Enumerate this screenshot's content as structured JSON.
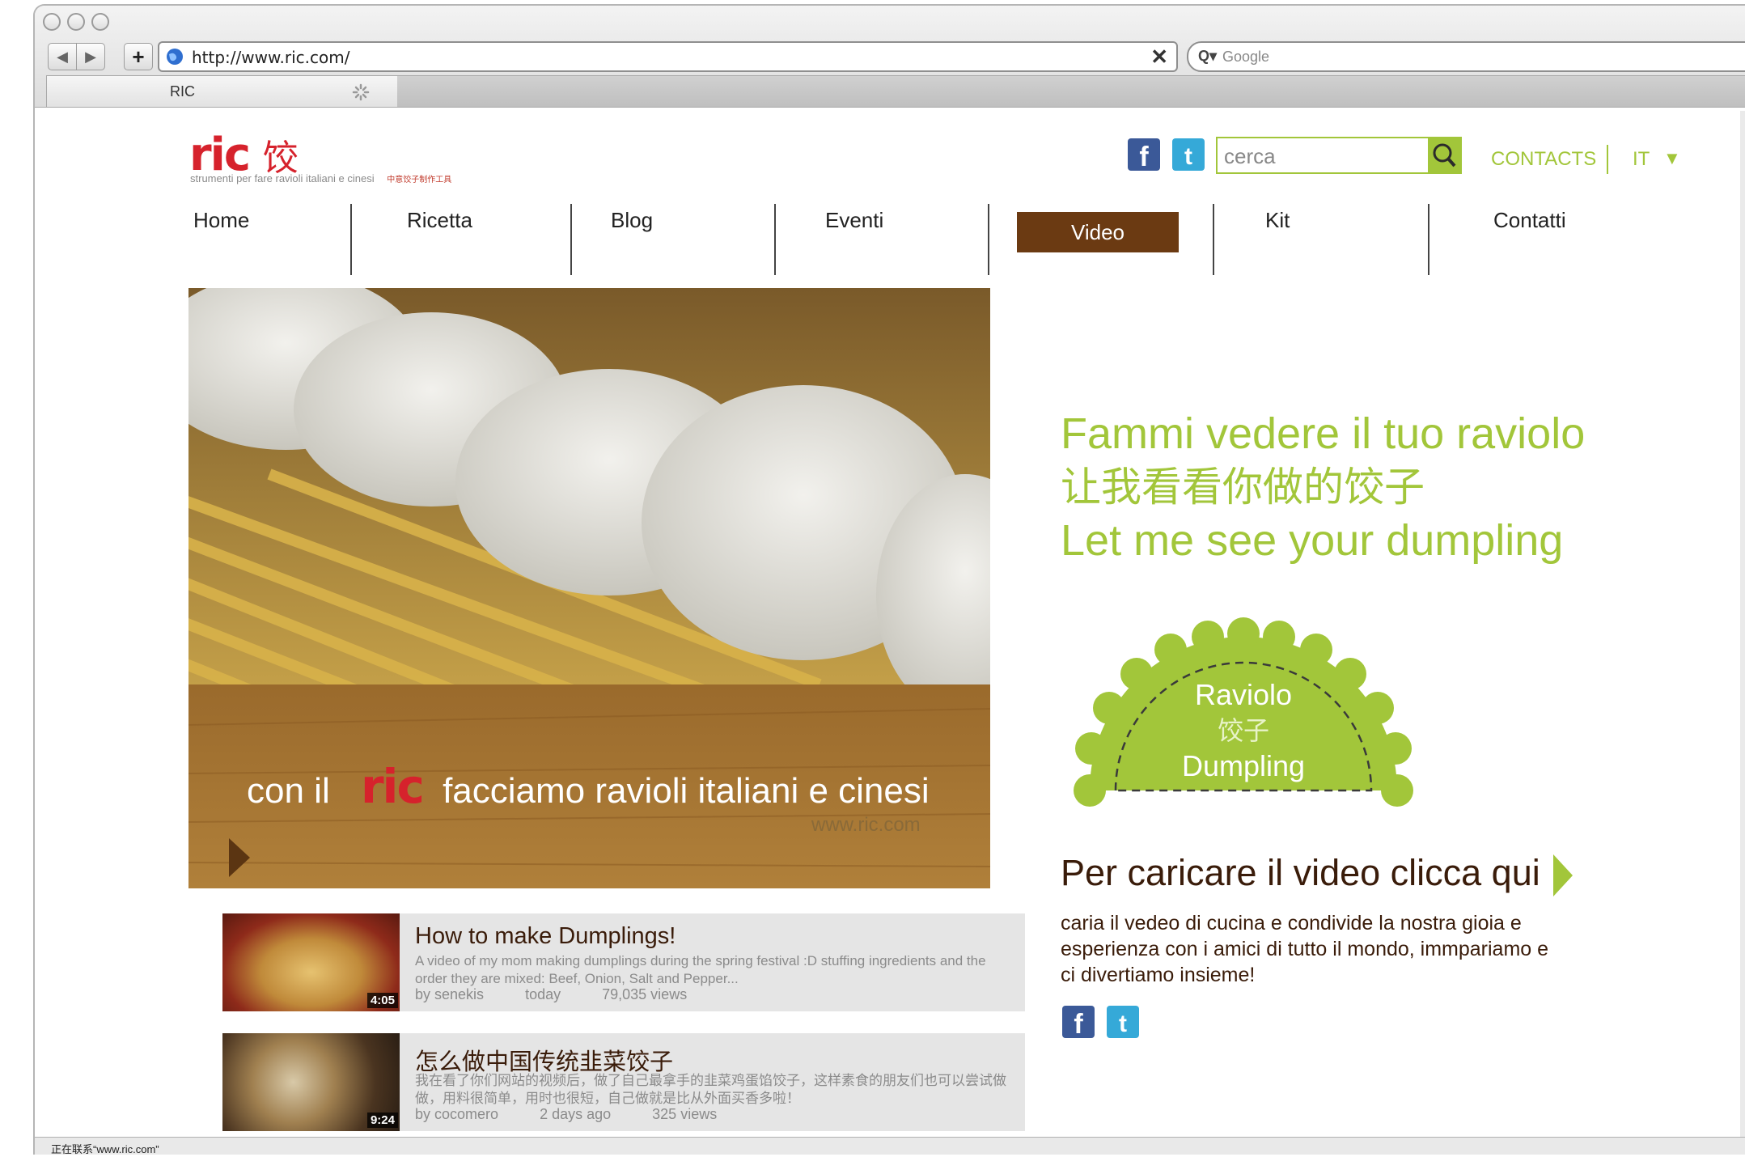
{
  "browser": {
    "url": "http://www.ric.com/",
    "search_placeholder": "Google",
    "tab_title": "RIC",
    "status": "正在联系“www.ric.com”",
    "back_label": "◀",
    "forward_label": "▶",
    "add_label": "+",
    "stop_label": "✕",
    "search_prefix": "Q▾"
  },
  "header": {
    "logo_text": "ric",
    "logo_char": "饺",
    "tagline": "strumenti per fare ravioli italiani e cinesi",
    "tagline_cn": "中意饺子制作工具",
    "search_placeholder": "cerca",
    "contacts_label": "CONTACTS",
    "lang_label": "IT",
    "lang_arrow": "▼"
  },
  "nav": {
    "items": [
      {
        "label": "Home"
      },
      {
        "label": "Ricetta"
      },
      {
        "label": "Blog"
      },
      {
        "label": "Eventi"
      },
      {
        "label": "Video"
      },
      {
        "label": "Kit"
      },
      {
        "label": "Contatti"
      }
    ],
    "active": "Video"
  },
  "hero": {
    "caption_pre": "con il",
    "caption_logo": "ric",
    "caption_post": "facciamo ravioli italiani e cinesi",
    "url": "www.ric.com"
  },
  "videos": [
    {
      "title": "How to make Dumplings!",
      "desc": "A video of my mom making dumplings during the spring festival :D stuffing ingredients and the order they are mixed: Beef, Onion, Salt and Pepper...",
      "author": "by senekis",
      "date": "today",
      "views": "79,035 views",
      "duration": "4:05"
    },
    {
      "title": "怎么做中国传统韭菜饺子",
      "desc": "我在看了你们网站的视频后，做了自己最拿手的韭菜鸡蛋馅饺子，这样素食的朋友们也可以尝试做做，用料很简单，用时也很短，自己做就是比从外面买香多啦！",
      "author": "by cocomero",
      "date": "2 days ago",
      "views": "325 views",
      "duration": "9:24"
    }
  ],
  "sidebar": {
    "headline_it": "Fammi vedere il tuo raviolo",
    "headline_cn": "让我看看你做的饺子",
    "headline_en": "Let me see your dumpling",
    "badge_it": "Raviolo",
    "badge_cn": "饺子",
    "badge_en": "Dumpling",
    "upload_cta": "Per caricare il video clicca qui",
    "body": "caria il vedeo di cucina e condivide la nostra gioia e esperienza con i amici di tutto il mondo, immpariamo e ci divertiamo insieme!"
  },
  "colors": {
    "accent_green": "#a2c63a",
    "brand_red": "#d6222c",
    "nav_active": "#6b3a12",
    "text_brown": "#3a1c0a"
  }
}
